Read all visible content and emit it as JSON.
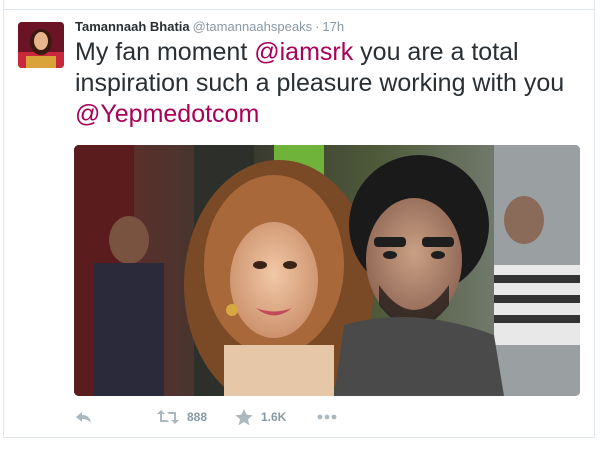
{
  "tweet": {
    "author_name": "Tamannaah Bhatia",
    "author_handle": "@tamannaahspeaks",
    "separator": "·",
    "timestamp": "17h",
    "text_part1": "My fan moment ",
    "mention1": "@iamsrk",
    "text_part2": " you are a total inspiration such a pleasure working with you ",
    "mention2": "@Yepmedotcom"
  },
  "actions": {
    "reply_icon": "reply-icon",
    "retweet_icon": "retweet-icon",
    "retweet_count": "888",
    "favorite_icon": "star-icon",
    "favorite_count": "1.6K",
    "more_icon": "more-dots-icon"
  },
  "colors": {
    "mention": "#a9005a",
    "text": "#292f33",
    "muted": "#8899a6",
    "icon": "#aab8c2"
  }
}
